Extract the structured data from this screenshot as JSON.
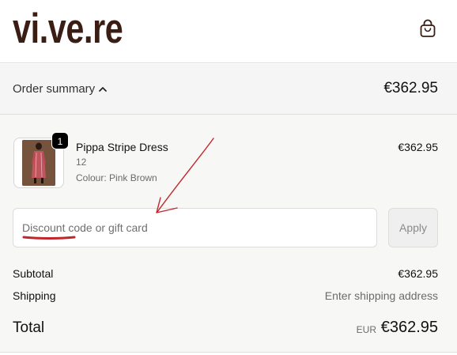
{
  "header": {
    "logo_text": "vi.ve.re",
    "icons": {
      "cart": "shopping-bag-icon"
    }
  },
  "summary": {
    "label": "Order summary",
    "total": "€362.95",
    "toggle_icon": "chevron-up-icon"
  },
  "line_item": {
    "name": "Pippa Stripe Dress",
    "size": "12",
    "colour": "Colour: Pink Brown",
    "price": "€362.95",
    "quantity": "1"
  },
  "discount": {
    "placeholder": "Discount code or gift card",
    "value": "",
    "apply_label": "Apply"
  },
  "totals": {
    "subtotal_label": "Subtotal",
    "subtotal_value": "€362.95",
    "shipping_label": "Shipping",
    "shipping_value": "Enter shipping address",
    "total_label": "Total",
    "currency": "EUR",
    "total_value": "€362.95"
  },
  "colors": {
    "logo": "#3a1e14",
    "annotation": "#c0272d",
    "summary_bg": "#f5f5f5",
    "main_bg": "#f7f7f5"
  }
}
